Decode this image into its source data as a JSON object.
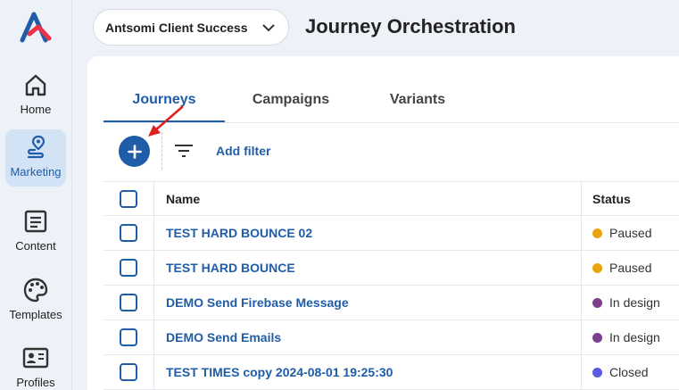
{
  "sidebar": {
    "logo": "antsomi-logo",
    "items": [
      {
        "label": "Home",
        "icon": "home-icon"
      },
      {
        "label": "Marketing",
        "icon": "marketing-route-icon",
        "active": true
      },
      {
        "label": "Content",
        "icon": "document-icon"
      },
      {
        "label": "Templates",
        "icon": "palette-icon"
      },
      {
        "label": "Profiles",
        "icon": "id-card-icon"
      }
    ]
  },
  "header": {
    "account": "Antsomi Client Success",
    "title": "Journey Orchestration"
  },
  "tabs": [
    {
      "label": "Journeys",
      "active": true
    },
    {
      "label": "Campaigns"
    },
    {
      "label": "Variants"
    }
  ],
  "toolbar": {
    "add_filter_label": "Add filter"
  },
  "table": {
    "columns": {
      "name": "Name",
      "status": "Status"
    },
    "rows": [
      {
        "name": "TEST HARD BOUNCE 02",
        "status": "Paused",
        "status_color": "#e8a40c"
      },
      {
        "name": "TEST HARD BOUNCE",
        "status": "Paused",
        "status_color": "#e8a40c"
      },
      {
        "name": "DEMO Send Firebase Message",
        "status": "In design",
        "status_color": "#7b3f8c"
      },
      {
        "name": "DEMO Send Emails",
        "status": "In design",
        "status_color": "#7b3f8c"
      },
      {
        "name": "TEST TIMES copy 2024-08-01 19:25:30",
        "status": "Closed",
        "status_color": "#5b5be0"
      }
    ]
  },
  "colors": {
    "accent": "#1f5da8",
    "annotation_arrow": "#e02020"
  }
}
